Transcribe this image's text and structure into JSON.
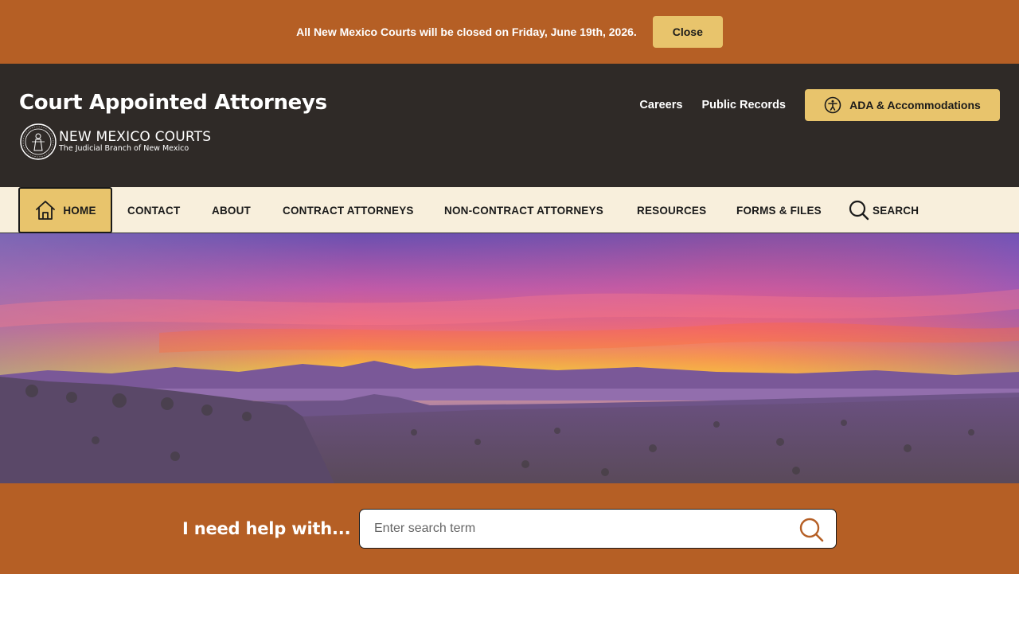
{
  "alert": {
    "message": "All New Mexico Courts will be closed on Friday, June 19th, 2026.",
    "close_label": "Close"
  },
  "header": {
    "site_title": "Court Appointed Attorneys",
    "logo_name": "NEW MEXICO COURTS",
    "logo_subtitle": "The Judicial Branch of New Mexico",
    "links": [
      {
        "label": "Careers"
      },
      {
        "label": "Public Records"
      }
    ],
    "ada_label": "ADA & Accommodations"
  },
  "nav": {
    "home": "HOME",
    "items": [
      "CONTACT",
      "ABOUT",
      "CONTRACT ATTORNEYS",
      "NON-CONTRACT ATTORNEYS",
      "RESOURCES",
      "FORMS & FILES"
    ],
    "search": "SEARCH"
  },
  "help": {
    "label": "I need help with...",
    "placeholder": "Enter search term"
  },
  "icons": {
    "seal": "court-seal-icon",
    "accessibility": "accessibility-icon",
    "home": "home-icon",
    "search": "search-icon"
  },
  "colors": {
    "brand_orange": "#b55f25",
    "header_dark": "#2f2a27",
    "accent_gold": "#e8c46c",
    "nav_cream": "#f8efdc"
  }
}
